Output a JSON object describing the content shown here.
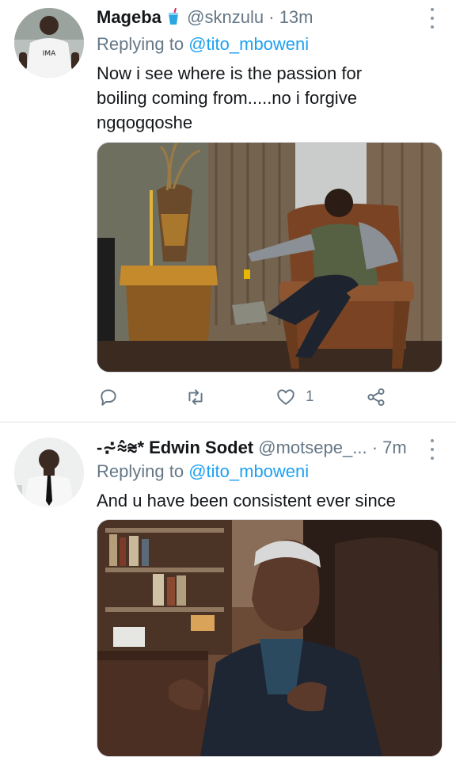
{
  "tweets": [
    {
      "name": "Mageba",
      "handle": "@sknzulu",
      "separator": "·",
      "time": "13m",
      "reply_prefix": "Replying to",
      "reply_mention": "@tito_mboweni",
      "text_lines": [
        "Now i see where is the passion for",
        "boiling coming from.....no i forgive",
        "ngqogqoshe"
      ],
      "avatar_print": "IMA",
      "media_icon": "photo-man-in-armchair",
      "actions": {
        "reply_icon": "reply-icon",
        "retweet_icon": "retweet-icon",
        "like_icon": "heart-icon",
        "like_count": "1",
        "share_icon": "share-icon"
      }
    },
    {
      "name": "-⩫⩯⩬* Edwin Sodet",
      "handle": "@motsepe_...",
      "separator": "·",
      "time": "7m",
      "reply_prefix": "Replying to",
      "reply_mention": "@tito_mboweni",
      "text_lines": [
        "And u have been consistent ever since"
      ],
      "media_icon": "photo-elderly-man-gesturing"
    }
  ],
  "colors": {
    "link": "#1da1f2",
    "secondary_text": "#657786",
    "divider": "#dfe3e6"
  }
}
